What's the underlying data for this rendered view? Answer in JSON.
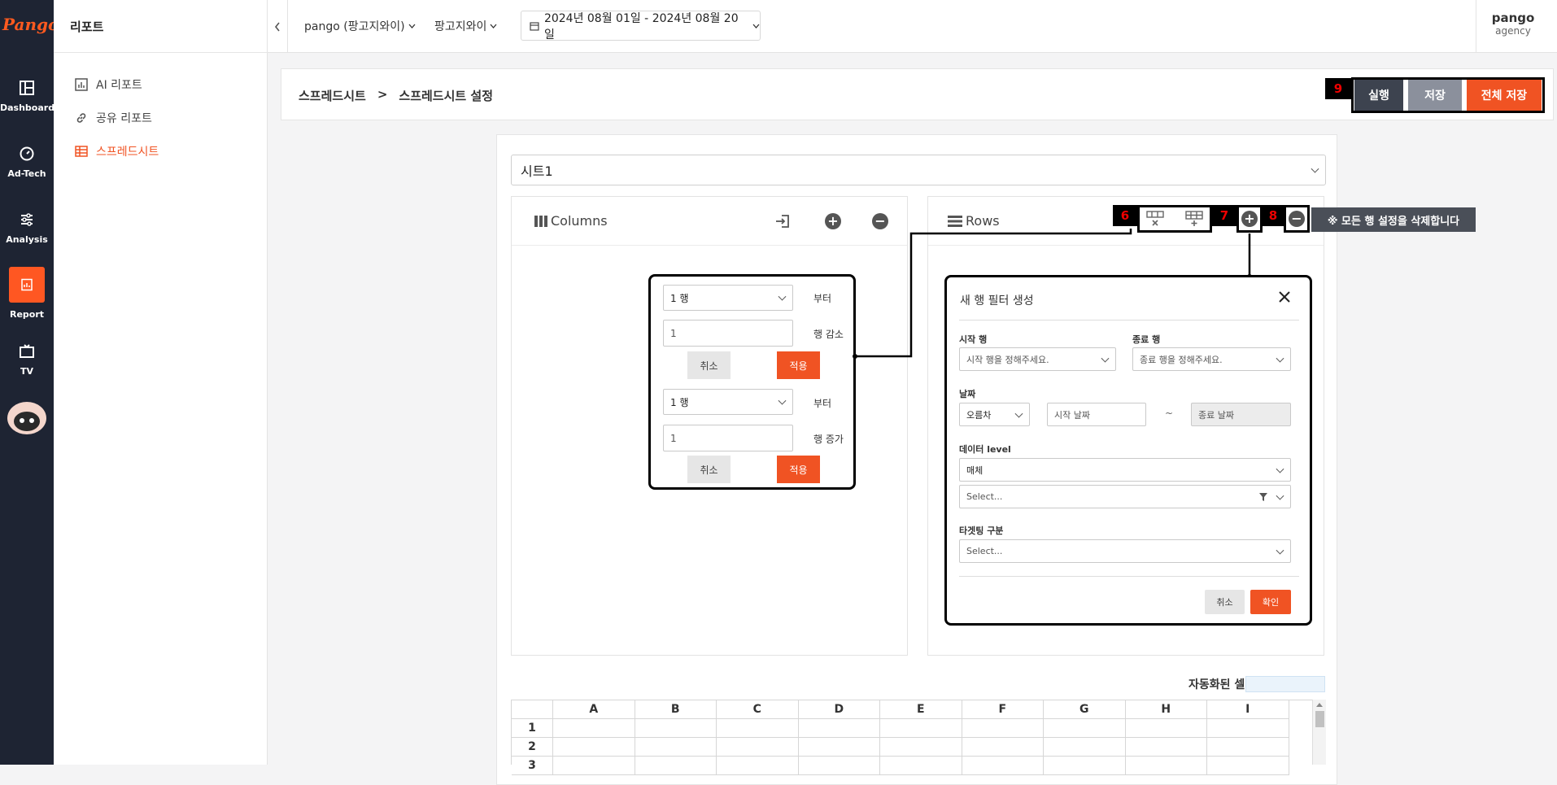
{
  "rail": {
    "logo": "Pango",
    "items": [
      {
        "label": "Dashboard",
        "icon": "dashboard-icon"
      },
      {
        "label": "Ad-Tech",
        "icon": "gauge-icon"
      },
      {
        "label": "Analysis",
        "icon": "sliders-icon"
      },
      {
        "label": "Report",
        "icon": "report-icon"
      },
      {
        "label": "TV",
        "icon": "tv-icon"
      }
    ]
  },
  "sidebar": {
    "title": "리포트",
    "items": [
      {
        "label": "AI 리포트",
        "icon": "chart-icon"
      },
      {
        "label": "공유 리포트",
        "icon": "link-icon"
      },
      {
        "label": "스프레드시트",
        "icon": "table-icon"
      }
    ]
  },
  "topbar": {
    "account": "pango (팡고지와이)",
    "brand": "팡고지와이",
    "date_range": "2024년 08월 01일 - 2024년 08월 20일",
    "user_name": "pango",
    "user_role": "agency"
  },
  "breadcrumb": {
    "parent": "스프레드시트",
    "sep": ">",
    "current": "스프레드시트 설정"
  },
  "actions": {
    "callout_number": "9",
    "run": "실행",
    "save": "저장",
    "save_all": "전체 저장"
  },
  "sheet": {
    "selected": "시트1"
  },
  "columns_panel": {
    "title": "Columns",
    "row_from_select": "1 행",
    "from_label": "부터",
    "decrease_value": "1",
    "decrease_label": "행 감소",
    "cancel": "취소",
    "apply": "적용",
    "row_from_select2": "1 행",
    "from_label2": "부터",
    "increase_value": "1",
    "increase_label": "행 증가",
    "cancel2": "취소",
    "apply2": "적용"
  },
  "rows_panel": {
    "title": "Rows",
    "num6": "6",
    "num7": "7",
    "num8": "8",
    "tooltip": "※ 모든 행 설정을 삭제합니다"
  },
  "filter_modal": {
    "title": "새 행 필터 생성",
    "start_row_label": "시작 행",
    "start_row_placeholder": "시작 행을 정해주세요.",
    "end_row_label": "종료 행",
    "end_row_placeholder": "종료 행을 정해주세요.",
    "date_label": "날짜",
    "date_order": "오름차",
    "start_date_placeholder": "시작 날짜",
    "tilde": "~",
    "end_date_placeholder": "종료 날짜",
    "data_level_label": "데이터 level",
    "data_level_value": "매체",
    "data_select_placeholder": "Select...",
    "targeting_label": "타겟팅 구분",
    "targeting_placeholder": "Select...",
    "cancel": "취소",
    "confirm": "확인"
  },
  "grid": {
    "auto_label": "자동화된 셀",
    "columns": [
      "A",
      "B",
      "C",
      "D",
      "E",
      "F",
      "G",
      "H",
      "I"
    ],
    "rows": [
      "1",
      "2",
      "3"
    ]
  },
  "colors": {
    "accent": "#f05323",
    "rail": "#1e2433"
  }
}
